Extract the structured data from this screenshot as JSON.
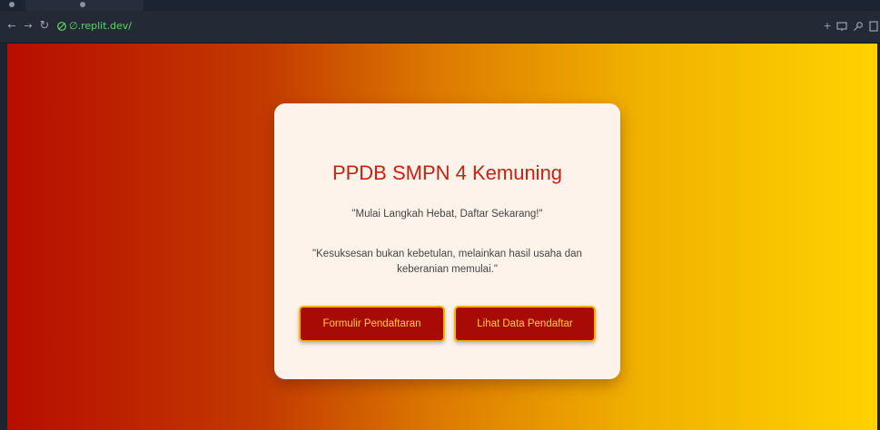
{
  "browser": {
    "url": "∅.replit.dev/",
    "url_color": "#62d46a",
    "icons": [
      "back-arrow-icon",
      "forward-arrow-icon",
      "reload-icon",
      "lock-icon",
      "plus-icon",
      "cast-icon",
      "key-icon",
      "menu-icon"
    ]
  },
  "page": {
    "title": "PPDB SMPN 4 Kemuning",
    "tagline": "\"Mulai Langkah Hebat, Daftar Sekarang!\"",
    "quote": "\"Kesuksesan bukan kebetulan, melainkan hasil usaha dan keberanian memulai.\"",
    "buttons": {
      "form_label": "Formulir Pendaftaran",
      "data_label": "Lihat Data Pendaftar"
    },
    "colors": {
      "title": "#c62210",
      "button_bg": "#a80a05",
      "button_text": "#ffd13a",
      "button_border": "#f5b300",
      "card_bg": "#fdf3ea"
    }
  }
}
